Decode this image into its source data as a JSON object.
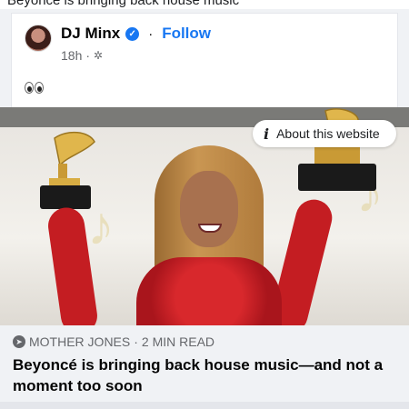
{
  "header_fragment": "Beyoncé is bringing back house music",
  "post": {
    "author_name": "DJ Minx",
    "separator": "·",
    "follow_label": "Follow",
    "timestamp": "18h",
    "meta_separator": "·",
    "audience_icon": "gear-icon",
    "text_icons": [
      "eyes-emoji"
    ]
  },
  "media": {
    "about_label": "About this website",
    "info_icon": "info-icon"
  },
  "link_preview": {
    "source": "MOTHER JONES",
    "source_separator": "·",
    "read_time": "2 MIN READ",
    "headline": "Beyoncé is bringing back house music—and not a moment too soon"
  },
  "colors": {
    "accent": "#1877f2",
    "background": "#f0f2f5",
    "dress": "#c41d22"
  }
}
